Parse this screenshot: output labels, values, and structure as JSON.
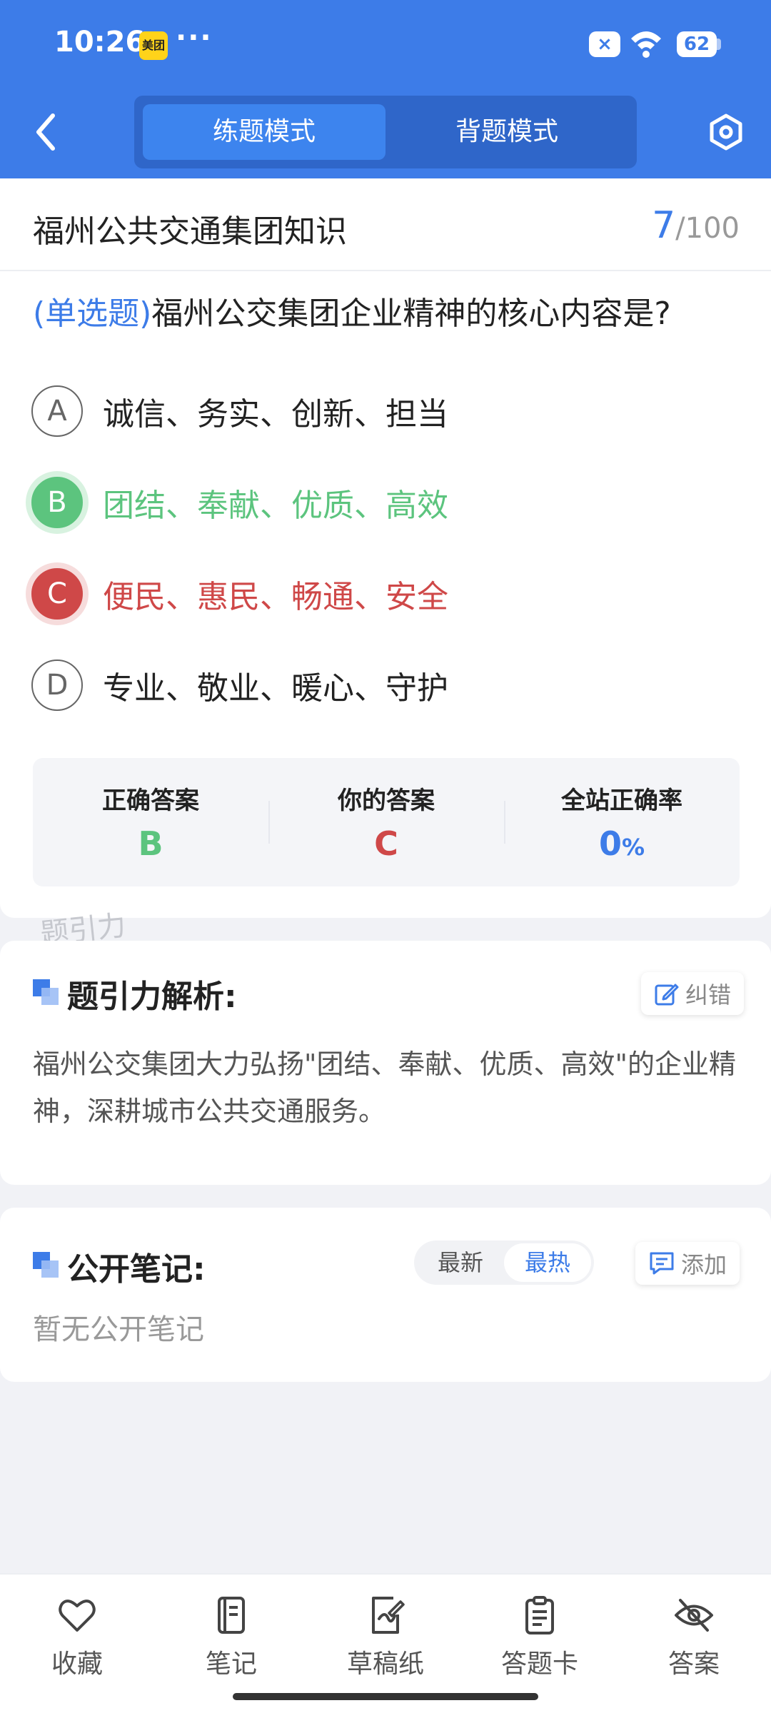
{
  "status_bar": {
    "time": "10:26",
    "app_badge": "美团",
    "more": "···",
    "battery": "62"
  },
  "header": {
    "tabs": [
      {
        "label": "练题模式",
        "active": true
      },
      {
        "label": "背题模式",
        "active": false
      }
    ],
    "accent_color": "#3d7ce8"
  },
  "quiz": {
    "category": "福州公共交通集团知识",
    "progress_current": "7",
    "progress_total": "/100",
    "question_type": "(单选题)",
    "question_text": "福州公交集团企业精神的核心内容是?",
    "options": [
      {
        "letter": "A",
        "text": "诚信、务实、创新、担当",
        "state": "normal"
      },
      {
        "letter": "B",
        "text": "团结、奉献、优质、高效",
        "state": "correct"
      },
      {
        "letter": "C",
        "text": "便民、惠民、畅通、安全",
        "state": "wrong"
      },
      {
        "letter": "D",
        "text": "专业、敬业、暖心、守护",
        "state": "normal"
      }
    ],
    "answer_summary": {
      "correct_label": "正确答案",
      "correct_value": "B",
      "yours_label": "你的答案",
      "yours_value": "C",
      "rate_label": "全站正确率",
      "rate_value": "0",
      "rate_unit": "%"
    },
    "watermark": "题引力"
  },
  "analysis": {
    "title": "题引力解析:",
    "report_label": "纠错",
    "text": "福州公交集团大力弘扬\"团结、奉献、优质、高效\"的企业精神，深耕城市公共交通服务。"
  },
  "notes": {
    "title": "公开笔记:",
    "sort_options": [
      "最新",
      "最热"
    ],
    "sort_active": "最热",
    "add_label": "添加",
    "empty_text": "暂无公开笔记"
  },
  "bottom_nav": {
    "items": [
      {
        "label": "收藏",
        "icon": "heart-icon"
      },
      {
        "label": "笔记",
        "icon": "notebook-icon"
      },
      {
        "label": "草稿纸",
        "icon": "draft-icon"
      },
      {
        "label": "答题卡",
        "icon": "answer-sheet-icon"
      },
      {
        "label": "答案",
        "icon": "eye-off-icon"
      }
    ]
  }
}
